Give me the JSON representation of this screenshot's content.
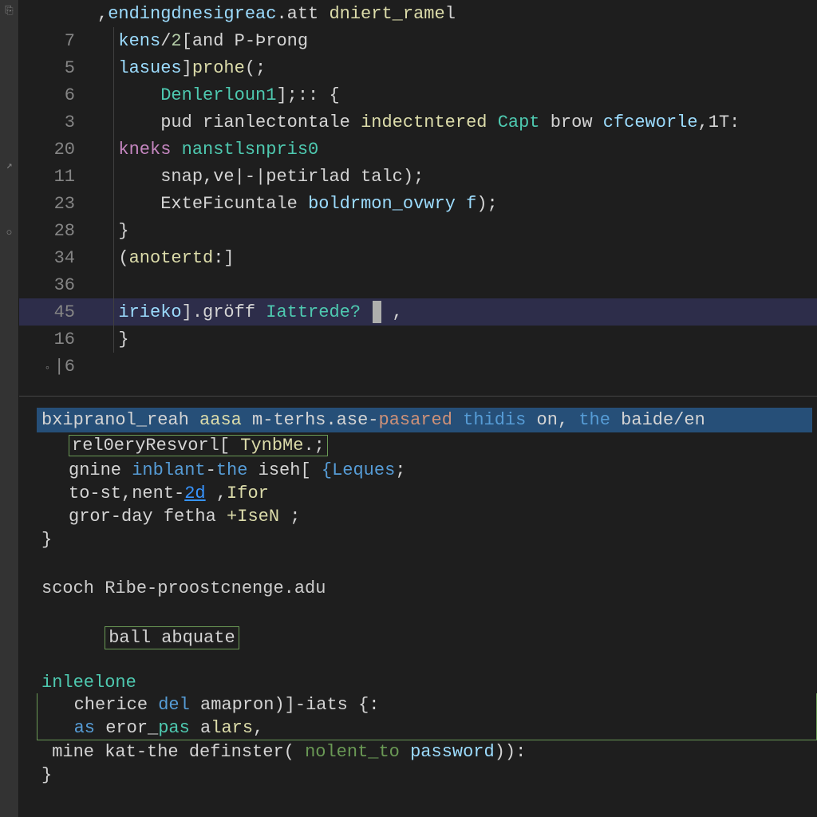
{
  "sidebar": {
    "icons": [
      "file",
      "arrow",
      "dot"
    ]
  },
  "editor": {
    "lines": [
      {
        "num": "",
        "tokens": [
          {
            "t": ",",
            "c": "punct"
          },
          {
            "t": "endingdnesigreac",
            "c": "var"
          },
          {
            "t": ".",
            "c": "punct"
          },
          {
            "t": "att ",
            "c": "plain"
          },
          {
            "t": "dniert_rame",
            "c": "func"
          },
          {
            "t": "l",
            "c": "plain"
          }
        ]
      },
      {
        "num": "7",
        "tokens": [
          {
            "t": "  ",
            "c": "plain"
          },
          {
            "t": "kens",
            "c": "var"
          },
          {
            "t": "/",
            "c": "punct"
          },
          {
            "t": "2",
            "c": "number"
          },
          {
            "t": "[",
            "c": "punct"
          },
          {
            "t": "and P-",
            "c": "plain"
          },
          {
            "t": "Þrong",
            "c": "plain"
          }
        ]
      },
      {
        "num": "5",
        "tokens": [
          {
            "t": "  ",
            "c": "plain"
          },
          {
            "t": "lasues",
            "c": "var"
          },
          {
            "t": "]",
            "c": "punct"
          },
          {
            "t": "prohe",
            "c": "func"
          },
          {
            "t": "(;",
            "c": "punct"
          }
        ]
      },
      {
        "num": "6",
        "tokens": [
          {
            "t": "      ",
            "c": "plain"
          },
          {
            "t": "Denlerloun1",
            "c": "class"
          },
          {
            "t": "];:: {",
            "c": "punct"
          }
        ]
      },
      {
        "num": "3",
        "tokens": [
          {
            "t": "      ",
            "c": "plain"
          },
          {
            "t": "pud rianlectontale ",
            "c": "plain"
          },
          {
            "t": "indectntered",
            "c": "func"
          },
          {
            "t": " ",
            "c": "plain"
          },
          {
            "t": "Capt",
            "c": "class"
          },
          {
            "t": " brow ",
            "c": "plain"
          },
          {
            "t": "cfceworle",
            "c": "var"
          },
          {
            "t": ",1T:",
            "c": "plain"
          }
        ]
      },
      {
        "num": "20",
        "tokens": [
          {
            "t": "  ",
            "c": "plain"
          },
          {
            "t": "kneks",
            "c": "special"
          },
          {
            "t": " ",
            "c": "plain"
          },
          {
            "t": "nanstlsnpris0",
            "c": "class"
          }
        ]
      },
      {
        "num": "11",
        "tokens": [
          {
            "t": "      ",
            "c": "plain"
          },
          {
            "t": "snap,ve",
            "c": "plain"
          },
          {
            "t": "|-|petirlad talc",
            "c": "plain"
          },
          {
            "t": ");",
            "c": "punct"
          }
        ]
      },
      {
        "num": "23",
        "tokens": [
          {
            "t": "      ",
            "c": "plain"
          },
          {
            "t": "ExteFicuntale ",
            "c": "plain"
          },
          {
            "t": "boldrmon_ovwry",
            "c": "var"
          },
          {
            "t": " ",
            "c": "plain"
          },
          {
            "t": "f",
            "c": "var"
          },
          {
            "t": ");",
            "c": "punct"
          }
        ]
      },
      {
        "num": "28",
        "tokens": [
          {
            "t": "  }",
            "c": "punct"
          }
        ]
      },
      {
        "num": "34",
        "tokens": [
          {
            "t": "  ",
            "c": "plain"
          },
          {
            "t": "(",
            "c": "punct"
          },
          {
            "t": "anotertd",
            "c": "func"
          },
          {
            "t": ":]",
            "c": "punct"
          }
        ]
      },
      {
        "num": "36",
        "tokens": []
      },
      {
        "num": "45",
        "highlighted": true,
        "tokens": [
          {
            "t": "  ",
            "c": "plain"
          },
          {
            "t": "irieko",
            "c": "var"
          },
          {
            "t": "].",
            "c": "punct"
          },
          {
            "t": "gröff",
            "c": "plain"
          },
          {
            "t": " ",
            "c": "plain"
          },
          {
            "t": "Iattrede?",
            "c": "class"
          },
          {
            "t": " ",
            "c": "plain",
            "cursor": true
          },
          {
            "t": " ,",
            "c": "punct"
          }
        ]
      },
      {
        "num": "16",
        "tokens": [
          {
            "t": "  }",
            "c": "punct"
          }
        ]
      }
    ],
    "fold_line": "6"
  },
  "panel_mid": {
    "header_tokens": [
      {
        "t": "bxipranol_reah",
        "c": "plain"
      },
      {
        "t": " ",
        "c": "plain"
      },
      {
        "t": "aasa",
        "c": "yellow"
      },
      {
        "t": " m-terhs.ase-",
        "c": "plain"
      },
      {
        "t": "pasared",
        "c": "orange"
      },
      {
        "t": " ",
        "c": "plain"
      },
      {
        "t": "thidis",
        "c": "blue"
      },
      {
        "t": " on, ",
        "c": "plain"
      },
      {
        "t": "the",
        "c": "blue"
      },
      {
        "t": " baide/en",
        "c": "plain"
      }
    ],
    "row2_tokens": [
      {
        "t": "rel0eryResvorl",
        "c": "plain"
      },
      {
        "t": "[ ",
        "c": "punct"
      },
      {
        "t": "TynbMe",
        "c": "yellow"
      },
      {
        "t": ".;",
        "c": "punct"
      }
    ],
    "rows": [
      [
        {
          "t": "gnine ",
          "c": "plain"
        },
        {
          "t": "inblant",
          "c": "blue"
        },
        {
          "t": "-",
          "c": "plain"
        },
        {
          "t": "the",
          "c": "blue"
        },
        {
          "t": " iseh[ ",
          "c": "plain"
        },
        {
          "t": "{Leques",
          "c": "blue"
        },
        {
          "t": ";",
          "c": "punct"
        }
      ],
      [
        {
          "t": "to-st,nent-",
          "c": "plain"
        },
        {
          "t": "2d",
          "c": "link"
        },
        {
          "t": " ,",
          "c": "plain"
        },
        {
          "t": "Ifor",
          "c": "yellow"
        }
      ],
      [
        {
          "t": "gror-day fetha ",
          "c": "plain"
        },
        {
          "t": "+IseN",
          "c": "yellow"
        },
        {
          "t": " ;",
          "c": "punct"
        }
      ]
    ],
    "closing": "}"
  },
  "panel_bottom": {
    "title": "scoch Ribe-proostcnenge.adu",
    "boxed1": "ball abquate",
    "line2": [
      {
        "t": "inleelone",
        "c": "cyan"
      }
    ],
    "lines": [
      [
        {
          "t": "   cherice ",
          "c": "plain"
        },
        {
          "t": "del",
          "c": "blue"
        },
        {
          "t": " amapron)]-iats {:",
          "c": "plain"
        }
      ],
      [
        {
          "t": "   ",
          "c": "plain"
        },
        {
          "t": "as",
          "c": "blue"
        },
        {
          "t": " eror_",
          "c": "plain"
        },
        {
          "t": "pas",
          "c": "cyan"
        },
        {
          "t": " a",
          "c": "plain"
        },
        {
          "t": "lars",
          "c": "yellow"
        },
        {
          "t": ",",
          "c": "plain"
        }
      ],
      [
        {
          "t": " mine kat-the definster( ",
          "c": "plain"
        },
        {
          "t": "nolent_to",
          "c": "green"
        },
        {
          "t": " ",
          "c": "plain"
        },
        {
          "t": "password",
          "c": "lblue"
        },
        {
          "t": ")):",
          "c": "plain"
        }
      ]
    ],
    "closing": "}"
  }
}
